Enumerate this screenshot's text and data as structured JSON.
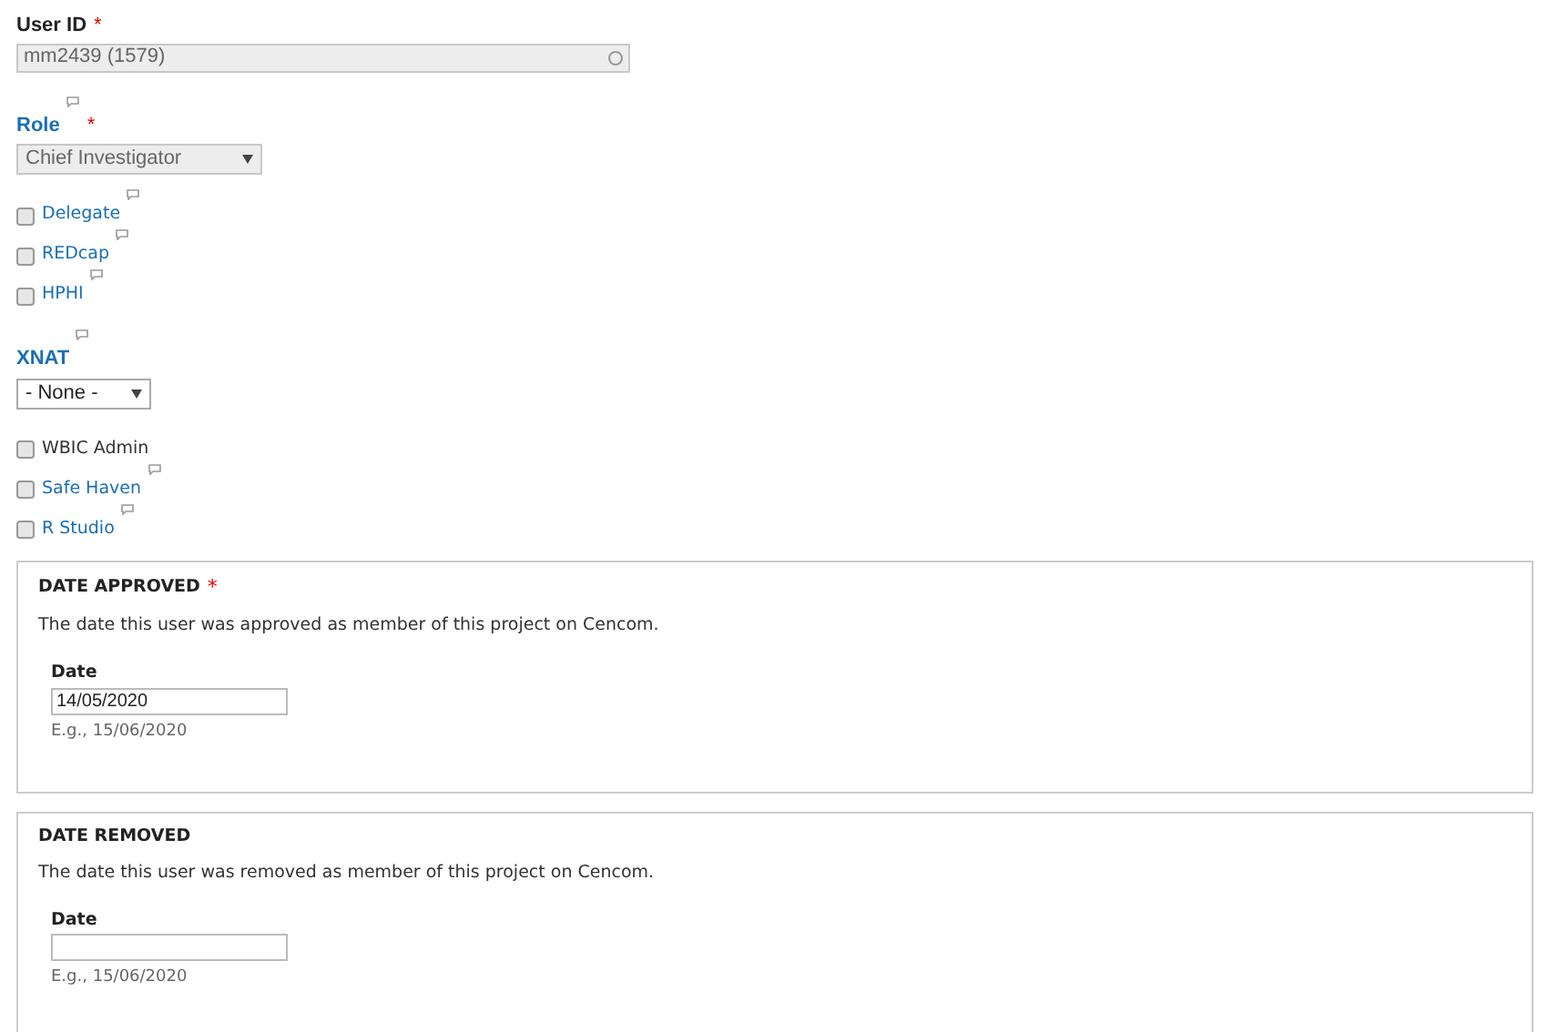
{
  "user_id": {
    "label": "User ID",
    "required_mark": "*",
    "value": "mm2439 (1579)",
    "disabled": true
  },
  "role": {
    "label": "Role",
    "has_help": true,
    "required_mark": "*",
    "value": "Chief Investigator",
    "disabled": true
  },
  "checkboxes_1": [
    {
      "label": "Delegate",
      "checked": false,
      "link": true,
      "has_help": true
    },
    {
      "label": "REDcap",
      "checked": false,
      "link": true,
      "has_help": true
    },
    {
      "label": "HPHI",
      "checked": false,
      "link": true,
      "has_help": true
    }
  ],
  "xnat": {
    "label": "XNAT",
    "has_help": true,
    "value": "- None -",
    "disabled": false
  },
  "checkboxes_2": [
    {
      "label": "WBIC Admin",
      "checked": false,
      "link": false,
      "has_help": false
    },
    {
      "label": "Safe Haven",
      "checked": false,
      "link": true,
      "has_help": true
    },
    {
      "label": "R Studio",
      "checked": false,
      "link": true,
      "has_help": true
    }
  ],
  "fieldsets": [
    {
      "legend": "DATE APPROVED",
      "required_mark": "*",
      "description": "The date this user was approved as member of this project on Cencom.",
      "date_label": "Date",
      "value": "14/05/2020",
      "example": "E.g., 15/06/2020"
    },
    {
      "legend": "DATE REMOVED",
      "description": "The date this user was removed as member of this project on Cencom.",
      "date_label": "Date",
      "example": "E.g., 15/06/2020"
    }
  ]
}
